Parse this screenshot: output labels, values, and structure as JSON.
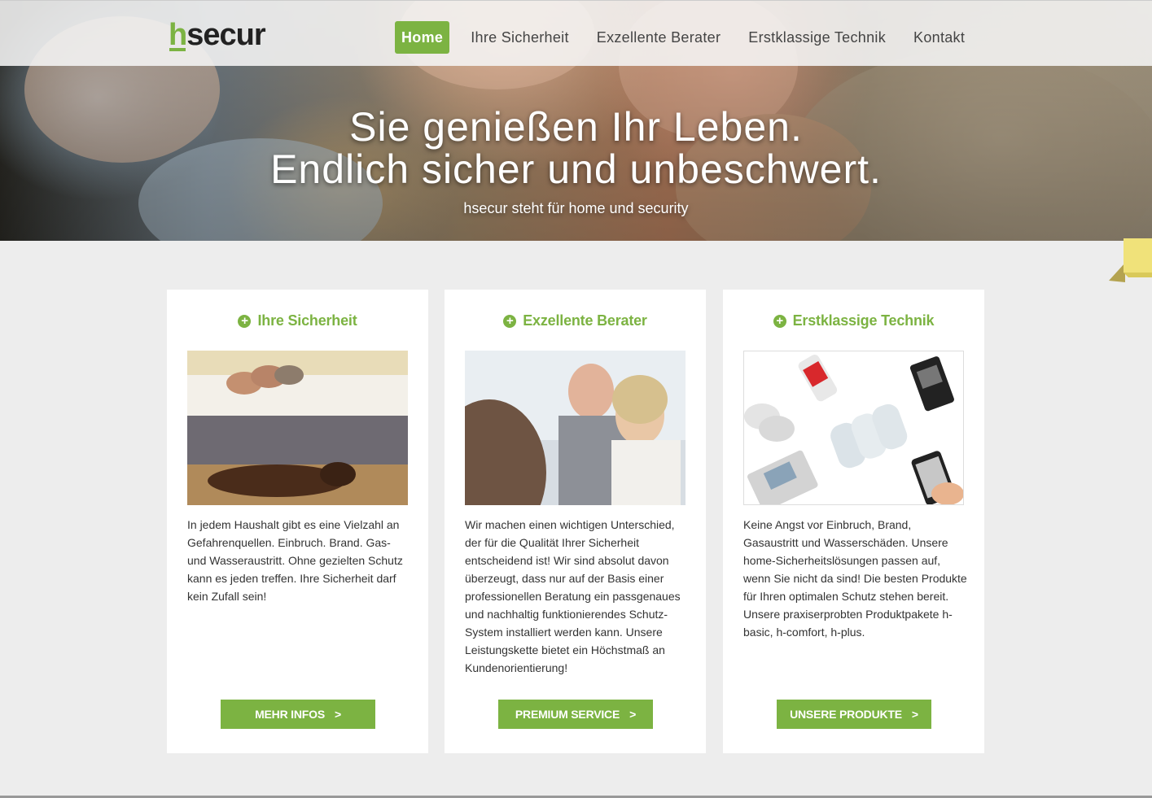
{
  "brand": {
    "logo_h": "h",
    "logo_rest": "secur",
    "accent": "#7cb342"
  },
  "nav": {
    "items": [
      {
        "label": "Home",
        "active": true
      },
      {
        "label": "Ihre Sicherheit"
      },
      {
        "label": "Exzellente Berater"
      },
      {
        "label": "Erstklassige Technik"
      },
      {
        "label": "Kontakt"
      }
    ]
  },
  "hero": {
    "title_line1": "Sie genießen Ihr Leben.",
    "title_line2": "Endlich sicher und unbeschwert.",
    "subtitle": "hsecur steht für home und security"
  },
  "cards": [
    {
      "title": "Ihre Sicherheit",
      "icon": "plus-circle-icon",
      "image": "bedroom-family-dog-photo",
      "text": "In jedem Haushalt gibt es eine Vielzahl an Gefahrenquellen. Einbruch. Brand. Gas- und Wasseraustritt. Ohne gezielten Schutz kann es jeden treffen. Ihre Sicherheit darf kein Zufall sein!",
      "button": "MEHR INFOS",
      "button_arrow": ">"
    },
    {
      "title": "Exzellente Berater",
      "icon": "plus-circle-icon",
      "image": "consultation-couple-photo",
      "text": "Wir machen einen wichtigen Unterschied, der für die Qualität Ihrer Sicherheit entscheidend ist! Wir sind absolut davon überzeugt, dass nur auf der Basis einer professionellen Beratung ein passgenaues und nachhaltig funktionierendes Schutz-System installiert werden kann. Unsere Leistungskette bietet ein Höchstmaß an Kundenorientierung!",
      "button": "PREMIUM SERVICE",
      "button_arrow": ">"
    },
    {
      "title": "Erstklassige Technik",
      "icon": "plus-circle-icon",
      "image": "security-devices-photo",
      "text": "Keine Angst vor Einbruch, Brand, Gasaustritt und Wasserschäden. Unsere home-Sicherheitslösungen passen auf, wenn Sie nicht da sind! Die besten Produkte für Ihren optimalen Schutz stehen bereit. Unsere praxiserprobten Produktpakete h-basic, h-comfort, h-plus.",
      "button": "UNSERE PRODUKTE",
      "button_arrow": ">"
    }
  ]
}
